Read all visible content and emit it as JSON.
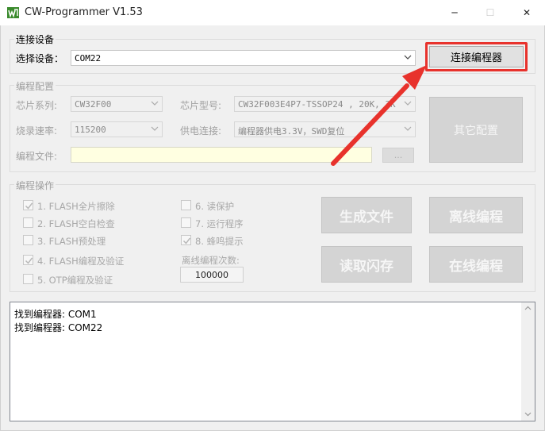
{
  "window": {
    "title": "CW-Programmer V1.53",
    "minimize_glyph": "─",
    "maximize_glyph": "☐",
    "close_glyph": "✕"
  },
  "connect_group": {
    "label": "连接设备",
    "select_device_label": "选择设备：",
    "device_value": "COM22",
    "connect_button": "连接编程器"
  },
  "config_group": {
    "label": "编程配置",
    "chip_series_label": "芯片系列:",
    "chip_series_value": "CW32F00",
    "chip_model_label": "芯片型号:",
    "chip_model_value": "CW32F003E4P7-TSSOP24 , 20K, 3K",
    "baud_label": "烧录速率:",
    "baud_value": "115200",
    "power_label": "供电连接:",
    "power_value": "编程器供电3.3V，SWD复位",
    "file_label": "编程文件:",
    "file_value": "",
    "browse_button": "...",
    "other_config_button": "其它配置"
  },
  "ops_group": {
    "label": "编程操作",
    "options": [
      {
        "label": "1. FLASH全片擦除",
        "checked": true
      },
      {
        "label": "2. FLASH空白检查",
        "checked": false
      },
      {
        "label": "3. FLASH预处理",
        "checked": false
      },
      {
        "label": "4. FLASH编程及验证",
        "checked": true
      },
      {
        "label": "5. OTP编程及验证",
        "checked": false
      },
      {
        "label": "6. 读保护",
        "checked": false
      },
      {
        "label": "7. 运行程序",
        "checked": false
      },
      {
        "label": "8. 蜂鸣提示",
        "checked": true
      }
    ],
    "offline_count_label": "离线编程次数:",
    "offline_count_value": "100000",
    "buttons": {
      "generate_file": "生成文件",
      "offline_program": "离线编程",
      "read_flash": "读取闪存",
      "online_program": "在线编程"
    }
  },
  "log": {
    "lines": [
      "找到编程器: COM1",
      "找到编程器: COM22"
    ]
  },
  "colors": {
    "highlight_red": "#e8322c",
    "disabled_text": "#a0a0a0",
    "file_field_bg": "#ffffe1"
  }
}
